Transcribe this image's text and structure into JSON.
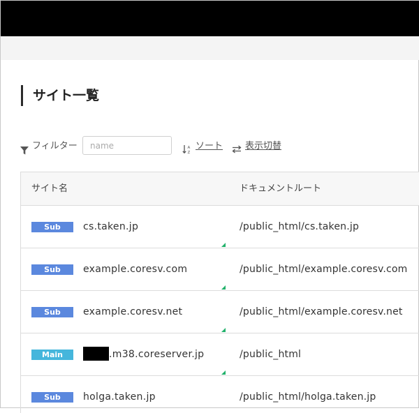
{
  "page": {
    "title": "サイト一覧"
  },
  "toolbar": {
    "filter_label": "フィルター",
    "search_placeholder": "name",
    "search_value": "",
    "sort_label": "ソート",
    "toggle_label": "表示切替"
  },
  "table": {
    "headers": {
      "site": "サイト名",
      "root": "ドキュメントルート"
    },
    "rows": [
      {
        "badge": "Sub",
        "site": "cs.taken.jp",
        "root": "/public_html/cs.taken.jp"
      },
      {
        "badge": "Sub",
        "site": "example.coresv.com",
        "root": "/public_html/example.coresv.com"
      },
      {
        "badge": "Sub",
        "site": "example.coresv.net",
        "root": "/public_html/example.coresv.net"
      },
      {
        "badge": "Main",
        "site": ".m38.coreserver.jp",
        "root": "/public_html"
      },
      {
        "badge": "Sub",
        "site": "holga.taken.jp",
        "root": "/public_html/holga.taken.jp"
      }
    ]
  },
  "colors": {
    "badge_sub": "#5b88de",
    "badge_main": "#45b6dc",
    "corner_mark": "#21b16b",
    "top_bar": "#000000"
  }
}
